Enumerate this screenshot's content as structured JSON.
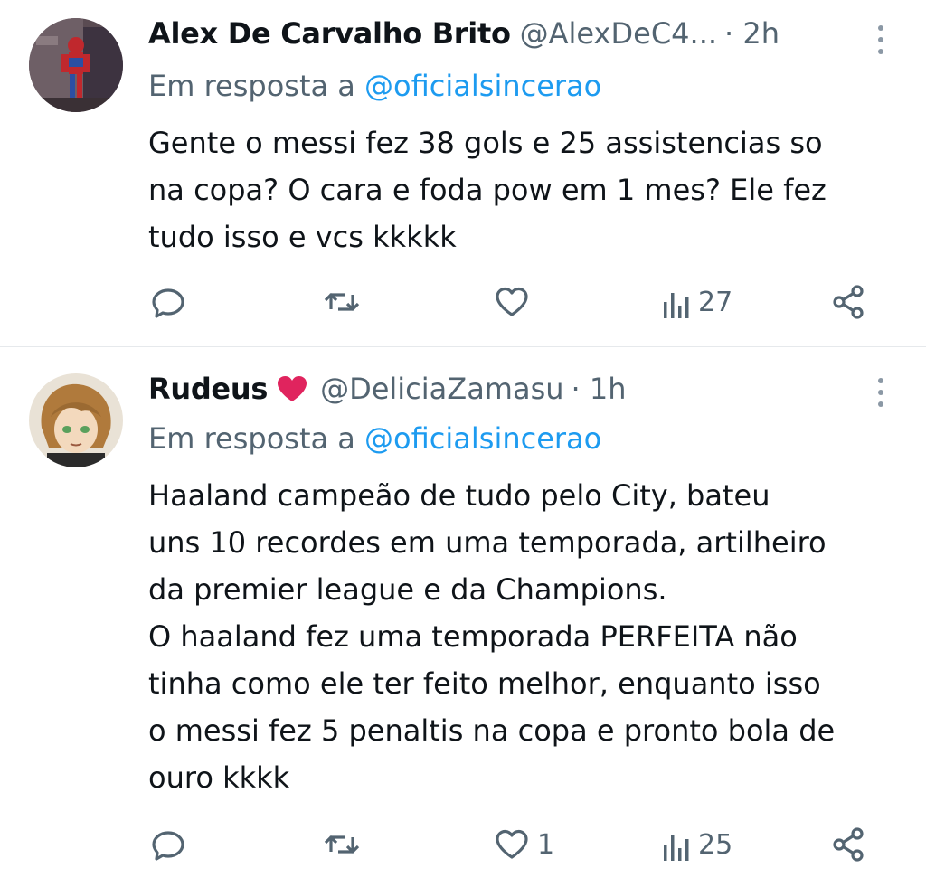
{
  "tweets": [
    {
      "author_name": "Alex De Carvalho Brito",
      "handle": "@AlexDeC4...",
      "time": "· 2h",
      "reply_prefix": "Em resposta a",
      "reply_to": "@oficialsincerao",
      "text_lines": [
        "Gente o messi fez 38 gols e 25 assistencias so",
        "na copa? O cara e foda pow em 1 mes? Ele fez",
        "tudo isso e vcs kkkkk"
      ],
      "likes": "",
      "views": "27",
      "avatar_icon": "spiderman-avatar"
    },
    {
      "author_name": "Rudeus",
      "name_emoji": "heart-emoji",
      "handle": "@DeliciaZamasu",
      "time": "· 1h",
      "reply_prefix": "Em resposta a",
      "reply_to": "@oficialsincerao",
      "text_lines": [
        "Haaland campeão de tudo pelo City, bateu",
        "uns 10 recordes em uma temporada, artilheiro",
        "da premier league e da Champions.",
        "O haaland fez uma temporada PERFEITA não",
        "tinha como ele ter feito melhor, enquanto isso",
        "o messi fez 5 penaltis na copa e pronto bola de",
        "ouro kkkk"
      ],
      "likes": "1",
      "views": "25",
      "avatar_icon": "anime-avatar"
    }
  ],
  "colors": {
    "text": "#0f1419",
    "secondary": "#536471",
    "mention": "#1d9bf0",
    "heart_emoji": "#e0245e",
    "divider": "#e6e9ec"
  }
}
